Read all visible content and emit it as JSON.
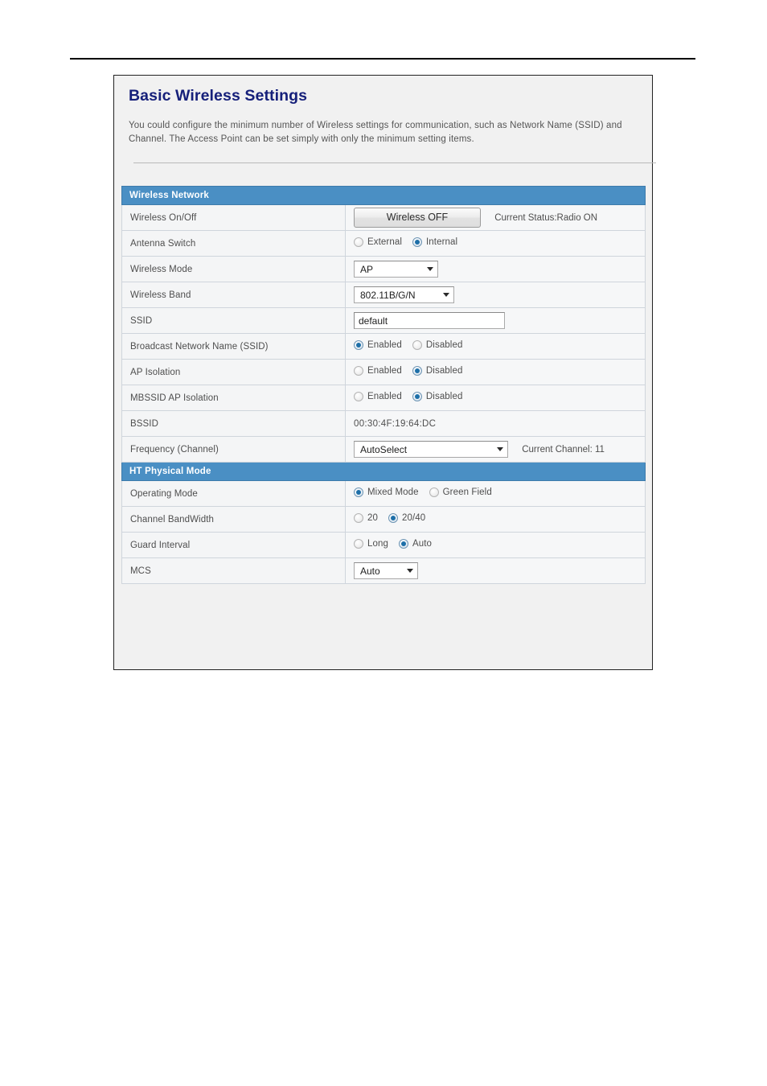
{
  "page": {
    "header_title": "Basic Wireless Settings",
    "header_description": "You could configure the minimum number of Wireless settings for communication, such as Network Name (SSID) and Channel. The Access Point can be set simply with only the minimum setting items.",
    "accent_blue": "#4a8fc4",
    "title_color": "#16207a"
  },
  "sections": {
    "wireless_network": {
      "title": "Wireless Network"
    },
    "ht_physical_mode": {
      "title": "HT Physical Mode"
    }
  },
  "rows": {
    "wireless_on_off": {
      "label": "Wireless On/Off",
      "button_label": "Wireless OFF",
      "status_text": "Current Status:Radio ON"
    },
    "antenna_switch": {
      "label": "Antenna Switch",
      "options": [
        "External",
        "Internal"
      ],
      "selected": "Internal"
    },
    "wireless_mode": {
      "label": "Wireless Mode",
      "selected": "AP"
    },
    "wireless_band": {
      "label": "Wireless Band",
      "selected": "802.11B/G/N"
    },
    "ssid": {
      "label": "SSID",
      "value": "default"
    },
    "broadcast_ssid": {
      "label": "Broadcast Network Name (SSID)",
      "options": [
        "Enabled",
        "Disabled"
      ],
      "selected": "Enabled"
    },
    "ap_isolation": {
      "label": "AP Isolation",
      "options": [
        "Enabled",
        "Disabled"
      ],
      "selected": "Disabled"
    },
    "mbssid_ap_isolation": {
      "label": "MBSSID AP Isolation",
      "options": [
        "Enabled",
        "Disabled"
      ],
      "selected": "Disabled"
    },
    "bssid": {
      "label": "BSSID",
      "value": "00:30:4F:19:64:DC"
    },
    "frequency_channel": {
      "label": "Frequency (Channel)",
      "selected": "AutoSelect",
      "note": "Current Channel: 11"
    },
    "operating_mode": {
      "label": "Operating Mode",
      "options": [
        "Mixed Mode",
        "Green Field"
      ],
      "selected": "Mixed Mode"
    },
    "channel_bandwidth": {
      "label": "Channel BandWidth",
      "options": [
        "20",
        "20/40"
      ],
      "selected": "20/40"
    },
    "guard_interval": {
      "label": "Guard Interval",
      "options": [
        "Long",
        "Auto"
      ],
      "selected": "Auto"
    },
    "mcs": {
      "label": "MCS",
      "selected": "Auto"
    }
  }
}
